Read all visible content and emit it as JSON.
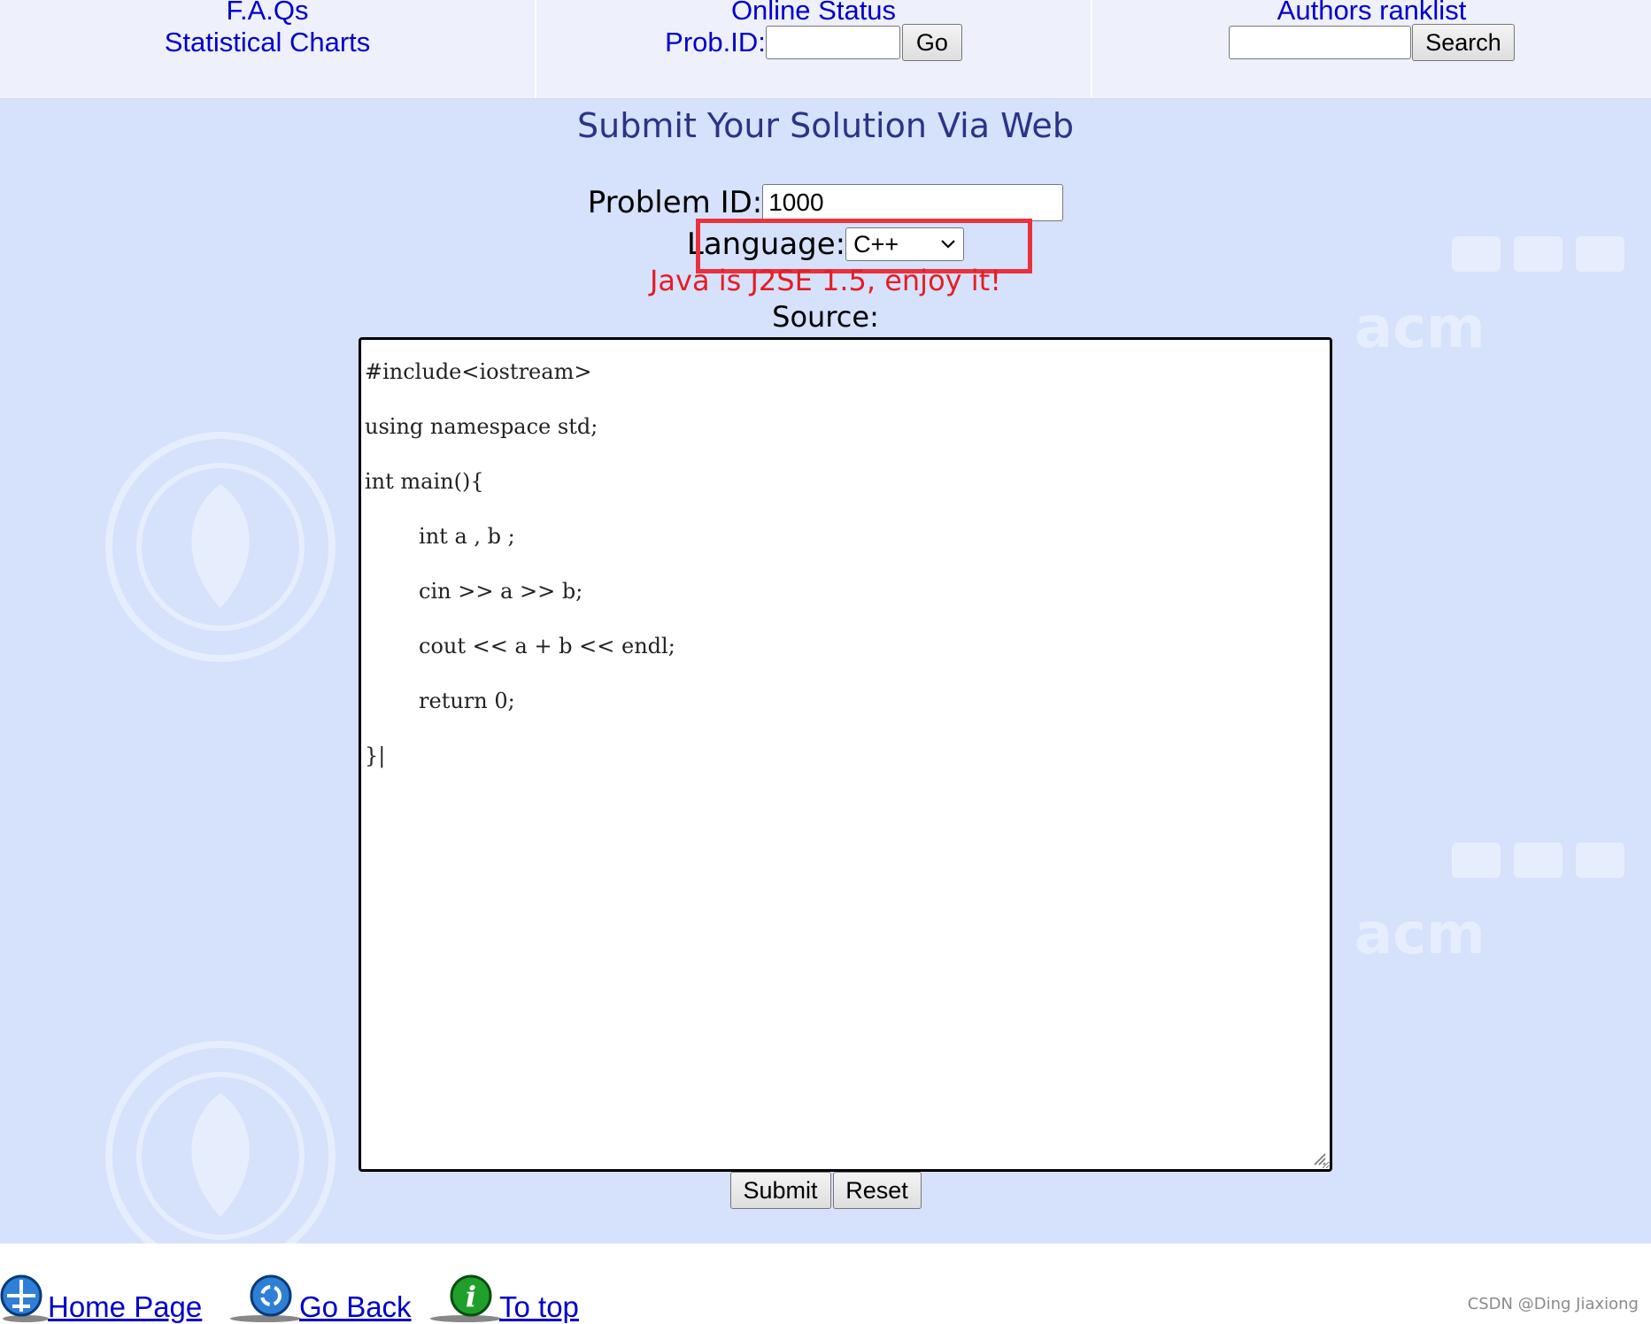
{
  "nav": {
    "faqs": "F.A.Qs",
    "charts": "Statistical Charts",
    "online_status": "Online Status",
    "prob_id_label": "Prob.ID:",
    "prob_id_value": "",
    "go_button": "Go",
    "authors_ranklist": "Authors ranklist",
    "search_value": "",
    "search_button": "Search"
  },
  "form": {
    "heading": "Submit Your Solution Via Web",
    "problem_id_label": "Problem ID:",
    "problem_id_value": "1000",
    "language_label": "Language:",
    "language_selected": "C++",
    "notice": "Java is J2SE 1.5, enjoy it!",
    "source_label": "Source:",
    "source_code": "#include<iostream>\nusing namespace std;\nint main(){\n        int a , b ;\n        cin >> a >> b;\n        cout << a + b << endl;\n        return 0;\n}|",
    "submit_button": "Submit",
    "reset_button": "Reset"
  },
  "footer": {
    "home": "Home Page",
    "back": "Go Back",
    "top": "To top",
    "credit": "CSDN @Ding Jiaxiong"
  },
  "colors": {
    "link": "#0000cc",
    "background": "#d6e1fb",
    "highlight": "#e8323c",
    "notice": "#e31e24"
  }
}
